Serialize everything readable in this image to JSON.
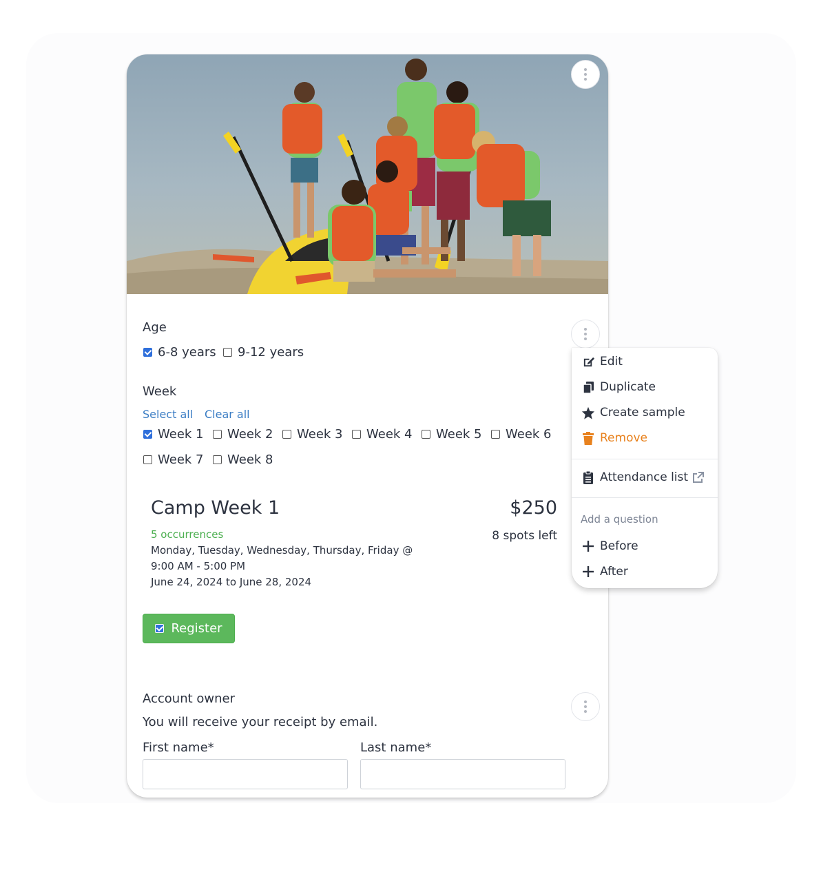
{
  "hero": {
    "image_alt": "Group of children in orange life jackets holding kayak paddles at a beach"
  },
  "age": {
    "label": "Age",
    "options": [
      {
        "label": "6-8 years",
        "checked": true
      },
      {
        "label": "9-12 years",
        "checked": false
      }
    ]
  },
  "week": {
    "label": "Week",
    "select_all": "Select all",
    "clear_all": "Clear all",
    "options": [
      {
        "label": "Week 1",
        "checked": true
      },
      {
        "label": "Week 2",
        "checked": false
      },
      {
        "label": "Week 3",
        "checked": false
      },
      {
        "label": "Week 4",
        "checked": false
      },
      {
        "label": "Week 5",
        "checked": false
      },
      {
        "label": "Week 6",
        "checked": false
      },
      {
        "label": "Week 7",
        "checked": false
      },
      {
        "label": "Week 8",
        "checked": false
      }
    ]
  },
  "camp": {
    "title": "Camp Week 1",
    "price": "$250",
    "spots": "8 spots left",
    "occurrences": "5 occurrences",
    "days": "Monday, Tuesday, Wednesday, Thursday, Friday @",
    "time": "9:00 AM - 5:00 PM",
    "dates": "June 24, 2024 to June 28, 2024",
    "register_label": "Register",
    "register_checked": true
  },
  "account": {
    "heading": "Account owner",
    "note": "You will receive your receipt by email.",
    "first_name_label": "First name*",
    "last_name_label": "Last name*",
    "first_name_value": "",
    "last_name_value": ""
  },
  "menu": {
    "items": [
      {
        "label": "Edit",
        "icon": "edit-icon"
      },
      {
        "label": "Duplicate",
        "icon": "copy-icon"
      },
      {
        "label": "Create sample",
        "icon": "star-icon"
      },
      {
        "label": "Remove",
        "icon": "trash-icon"
      }
    ],
    "attendance_label": "Attendance list",
    "attendance_icon": "external-link-icon",
    "add_question_heading": "Add a question",
    "before_label": "Before",
    "after_label": "After"
  },
  "colors": {
    "accent_blue": "#2f6fdb",
    "link_blue": "#3b7dc4",
    "register_green": "#5cb85c",
    "occurrences_green": "#4caf50",
    "remove_orange": "#e8821e"
  }
}
